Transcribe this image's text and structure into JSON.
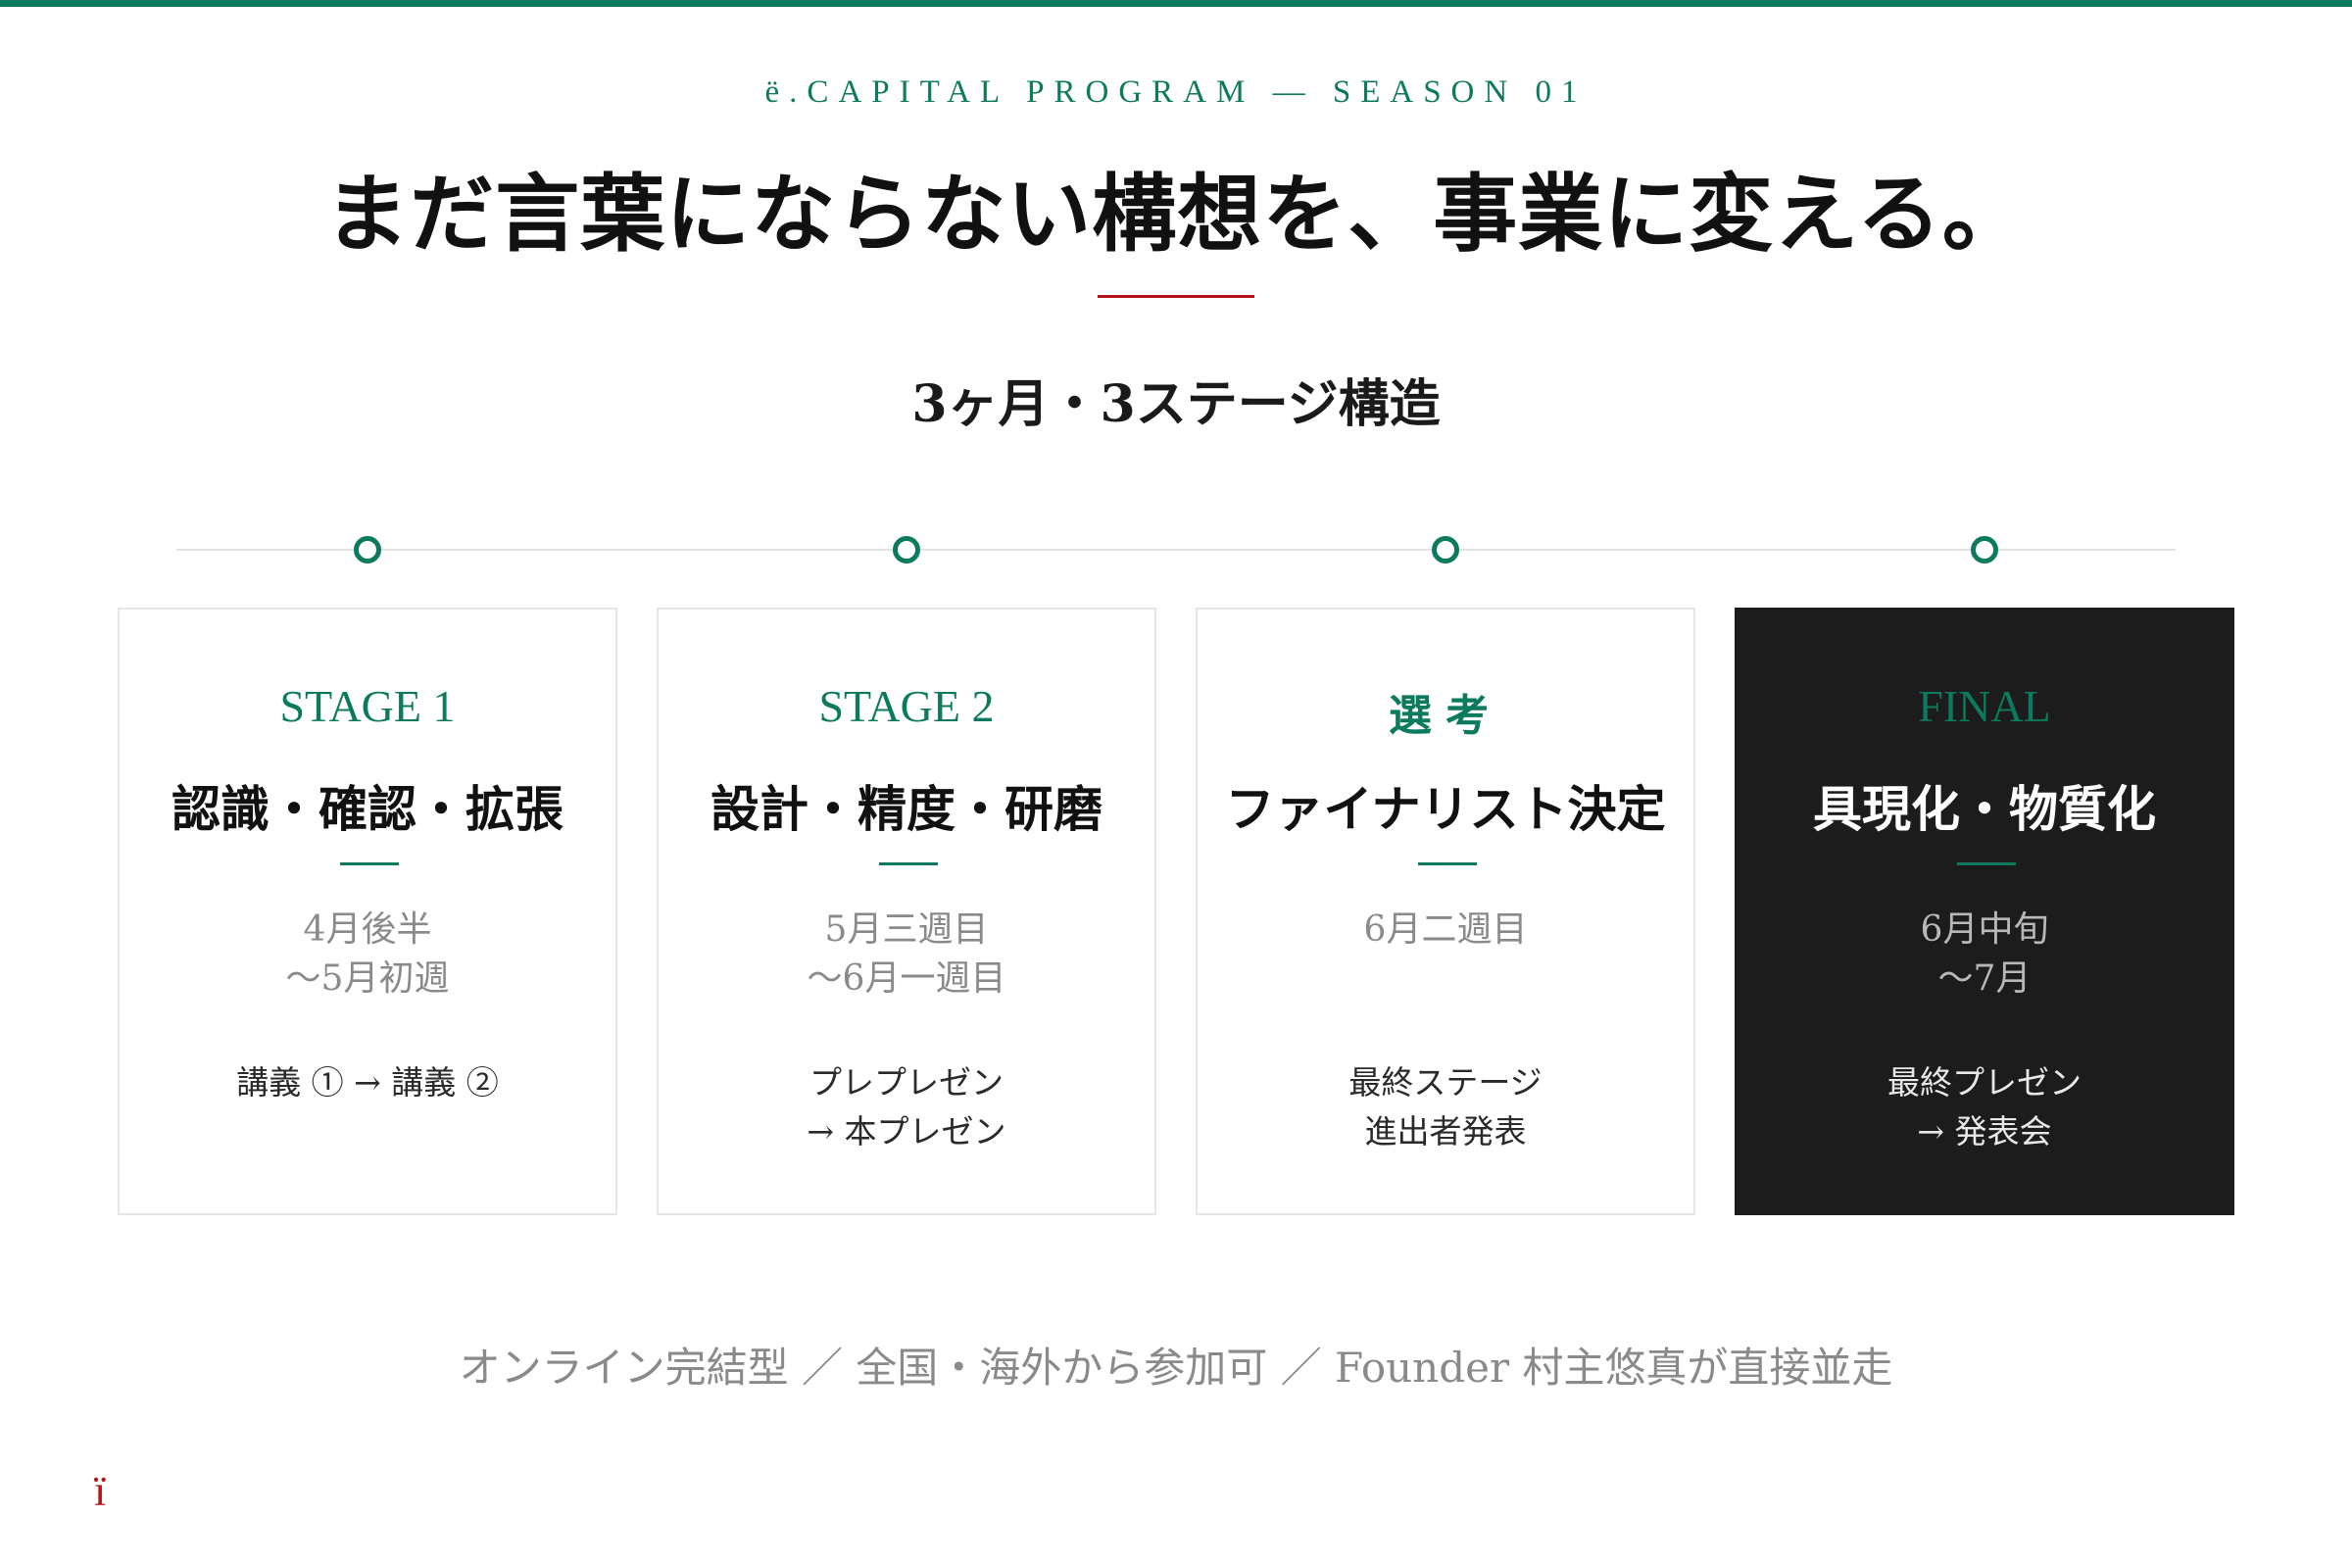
{
  "header": {
    "eyebrow": "ë.CAPITAL PROGRAM — SEASON 01",
    "headline": "まだ言葉にならない構想を、事業に変える。",
    "subhead": "3ヶ月・3ステージ構造"
  },
  "stages": [
    {
      "label": "STAGE 1",
      "title": "認識・確認・拡張",
      "period_line1": "4月後半",
      "period_line2": "〜5月初週",
      "detail_line1": "講義 ① → 講義 ②",
      "detail_line2": ""
    },
    {
      "label": "STAGE 2",
      "title": "設計・精度・研磨",
      "period_line1": "5月三週目",
      "period_line2": "〜6月一週目",
      "detail_line1": "プレプレゼン",
      "detail_line2": "→ 本プレゼン"
    },
    {
      "label": "選考",
      "title": "ファイナリスト決定",
      "period_line1": "6月二週目",
      "period_line2": "",
      "detail_line1": "最終ステージ",
      "detail_line2": "進出者発表"
    },
    {
      "label": "FINAL",
      "title": "具現化・物質化",
      "period_line1": "6月中旬",
      "period_line2": "〜7月",
      "detail_line1": "最終プレゼン",
      "detail_line2": "→ 発表会"
    }
  ],
  "footer": {
    "note": "オンライン完結型 ／ 全国・海外から参加可 ／ Founder 村主悠真が直接並走",
    "brand_mark": "ï"
  },
  "colors": {
    "accent_green": "#0c7a5c",
    "accent_red": "#b3141c",
    "dark_card": "#1c1c1c"
  }
}
